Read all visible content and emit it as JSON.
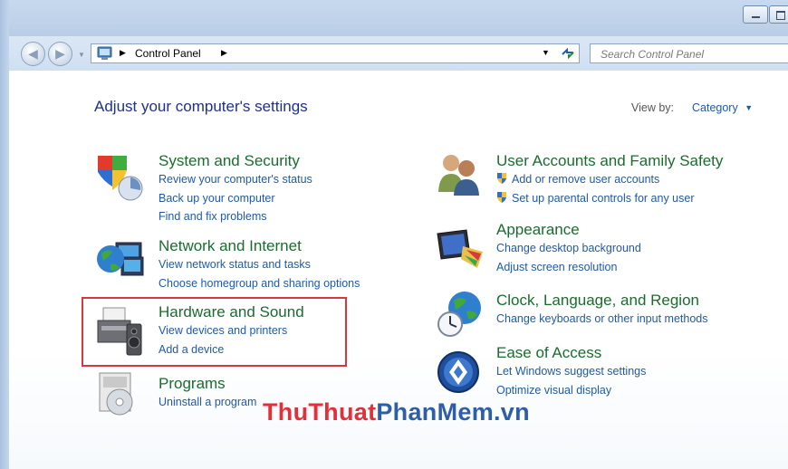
{
  "breadcrumb": {
    "root": "Control Panel"
  },
  "search": {
    "placeholder": "Search Control Panel"
  },
  "page": {
    "title": "Adjust your computer's settings"
  },
  "view_by": {
    "label": "View by:",
    "value": "Category"
  },
  "categories": {
    "system": {
      "title": "System and Security",
      "links": [
        "Review your computer's status",
        "Back up your computer",
        "Find and fix problems"
      ]
    },
    "network": {
      "title": "Network and Internet",
      "links": [
        "View network status and tasks",
        "Choose homegroup and sharing options"
      ]
    },
    "hardware": {
      "title": "Hardware and Sound",
      "links": [
        "View devices and printers",
        "Add a device"
      ]
    },
    "programs": {
      "title": "Programs",
      "links": [
        "Uninstall a program"
      ]
    },
    "users": {
      "title": "User Accounts and Family Safety",
      "links": [
        "Add or remove user accounts",
        "Set up parental controls for any user"
      ]
    },
    "appearance": {
      "title": "Appearance",
      "links": [
        "Change desktop background",
        "Adjust screen resolution"
      ]
    },
    "clock": {
      "title": "Clock, Language, and Region",
      "links": [
        "Change keyboards or other input methods"
      ]
    },
    "ease": {
      "title": "Ease of Access",
      "links": [
        "Let Windows suggest settings",
        "Optimize visual display"
      ]
    }
  },
  "watermark": {
    "part1": "ThuThuat",
    "part2": "PhanMem",
    "part3": ".vn"
  },
  "colors": {
    "title_text": "#1e3287",
    "category_title": "#1c6b2e",
    "link": "#1e5aa8",
    "highlight_box": "#d9373f",
    "watermark_red": "#e0303a",
    "watermark_blue": "#2f5ea8"
  }
}
